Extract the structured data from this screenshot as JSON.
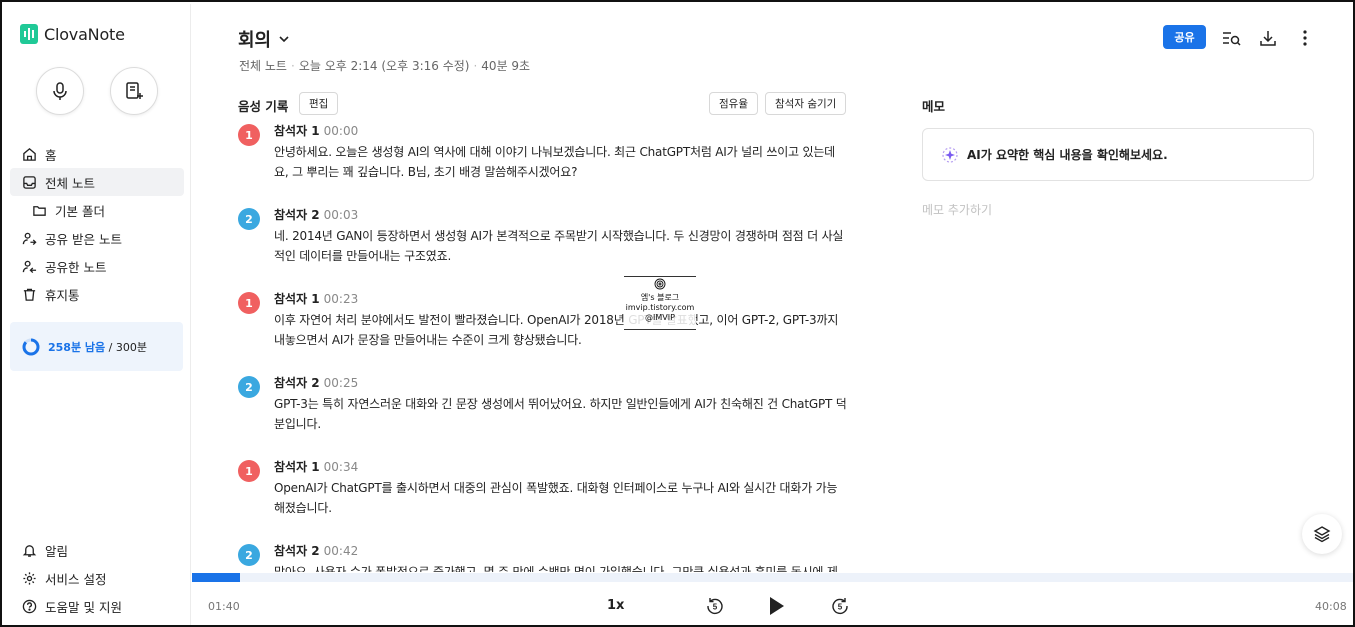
{
  "app": {
    "name": "ClovaNote"
  },
  "sidebar": {
    "items": [
      {
        "label": "홈",
        "icon": "home-icon"
      },
      {
        "label": "전체 노트",
        "icon": "inbox-icon",
        "active": true
      },
      {
        "label": "기본 폴더",
        "icon": "folder-icon"
      },
      {
        "label": "공유 받은 노트",
        "icon": "user-arrow-in-icon"
      },
      {
        "label": "공유한 노트",
        "icon": "user-arrow-out-icon"
      },
      {
        "label": "휴지통",
        "icon": "trash-icon"
      }
    ],
    "usage": {
      "remaining": "258분 남음",
      "total": "/ 300분"
    },
    "bottom_items": [
      {
        "label": "알림",
        "icon": "bell-icon"
      },
      {
        "label": "서비스 설정",
        "icon": "gear-icon"
      },
      {
        "label": "도움말 및 지원",
        "icon": "help-icon"
      }
    ]
  },
  "header": {
    "title": "회의",
    "breadcrumb": "전체 노트",
    "date": "오늘 오후 2:14 (오후 3:16 수정)",
    "duration": "40분 9초",
    "share_label": "공유"
  },
  "transcript": {
    "title": "음성 기록",
    "edit_label": "편집",
    "share_rate_label": "점유율",
    "hide_speaker_label": "참석자 숨기기",
    "entries": [
      {
        "num": "1",
        "speaker": "참석자 1",
        "time": "00:00",
        "text": "안녕하세요. 오늘은 생성형 AI의 역사에 대해 이야기 나눠보겠습니다. 최근 ChatGPT처럼 AI가 널리 쓰이고 있는데요, 그 뿌리는 꽤 깊습니다. B님, 초기 배경 말씀해주시겠어요?"
      },
      {
        "num": "2",
        "speaker": "참석자 2",
        "time": "00:03",
        "text": "네. 2014년 GAN이 등장하면서 생성형 AI가 본격적으로 주목받기 시작했습니다. 두 신경망이 경쟁하며 점점 더 사실적인 데이터를 만들어내는 구조였죠."
      },
      {
        "num": "1",
        "speaker": "참석자 1",
        "time": "00:23",
        "text": "이후 자연어 처리 분야에서도 발전이 빨라졌습니다. OpenAI가 2018년 GPT를 발표했고, 이어 GPT-2, GPT-3까지 내놓으면서 AI가 문장을 만들어내는 수준이 크게 향상됐습니다."
      },
      {
        "num": "2",
        "speaker": "참석자 2",
        "time": "00:25",
        "text": "GPT-3는 특히 자연스러운 대화와 긴 문장 생성에서 뛰어났어요. 하지만 일반인들에게 AI가 친숙해진 건 ChatGPT 덕분입니다."
      },
      {
        "num": "1",
        "speaker": "참석자 1",
        "time": "00:34",
        "text": "OpenAI가 ChatGPT를 출시하면서 대중의 관심이 폭발했죠. 대화형 인터페이스로 누구나 AI와 실시간 대화가 가능해졌습니다."
      },
      {
        "num": "2",
        "speaker": "참석자 2",
        "time": "00:42",
        "text": "맞아요. 사용자 수가 폭발적으로 증가했고, 몇 주 만에 수백만 명이 가입했습니다. 그만큼 실용성과 흥미를 동시에 제공했죠."
      }
    ]
  },
  "watermark": {
    "line1": "엠's 블로그",
    "line2": "imvip.tistory.com",
    "line3": "@IMVIP"
  },
  "memo": {
    "title": "메모",
    "ai_summary": "AI가 요약한 핵심 내용을 확인해보세요.",
    "add_placeholder": "메모 추가하기"
  },
  "player": {
    "current_time": "01:40",
    "total_time": "40:08",
    "speed": "1x",
    "skip_seconds": "5",
    "progress_fraction": 0.0415
  },
  "colors": {
    "accent": "#1a73e8",
    "speaker1": "#f06060",
    "speaker2": "#3aa8e0"
  }
}
